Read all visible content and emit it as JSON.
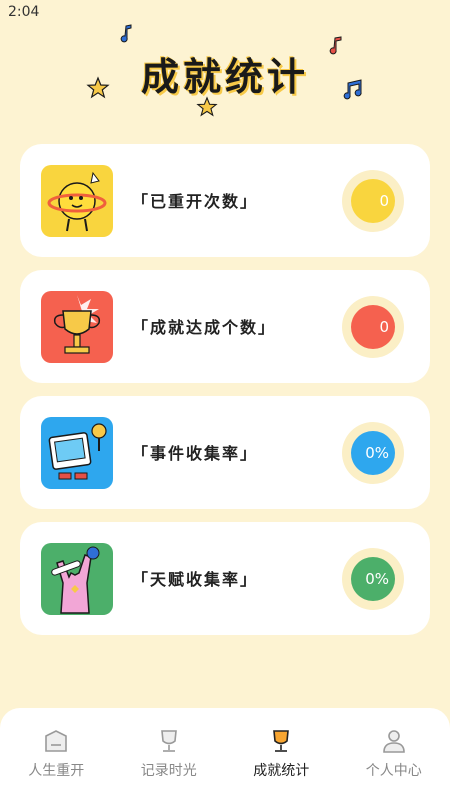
{
  "status_bar": {
    "time": "2:04"
  },
  "header": {
    "title": "成就统计"
  },
  "cards": [
    {
      "label": "「已重开次数」",
      "value": "0",
      "color": "#f9d53e",
      "icon": "sun-mascot-icon"
    },
    {
      "label": "「成就达成个数」",
      "value": "0",
      "color": "#f5614f",
      "icon": "trophy-icon"
    },
    {
      "label": "「事件收集率」",
      "value": "0%",
      "color": "#2ea7ee",
      "icon": "computer-mascot-icon"
    },
    {
      "label": "「天赋收集率」",
      "value": "0%",
      "color": "#4caf6a",
      "icon": "rock-hand-icon"
    }
  ],
  "nav": [
    {
      "label": "人生重开",
      "icon": "box-icon",
      "active": false
    },
    {
      "label": "记录时光",
      "icon": "cup-icon",
      "active": false
    },
    {
      "label": "成就统计",
      "icon": "trophy-icon",
      "active": true
    },
    {
      "label": "个人中心",
      "icon": "person-icon",
      "active": false
    }
  ]
}
